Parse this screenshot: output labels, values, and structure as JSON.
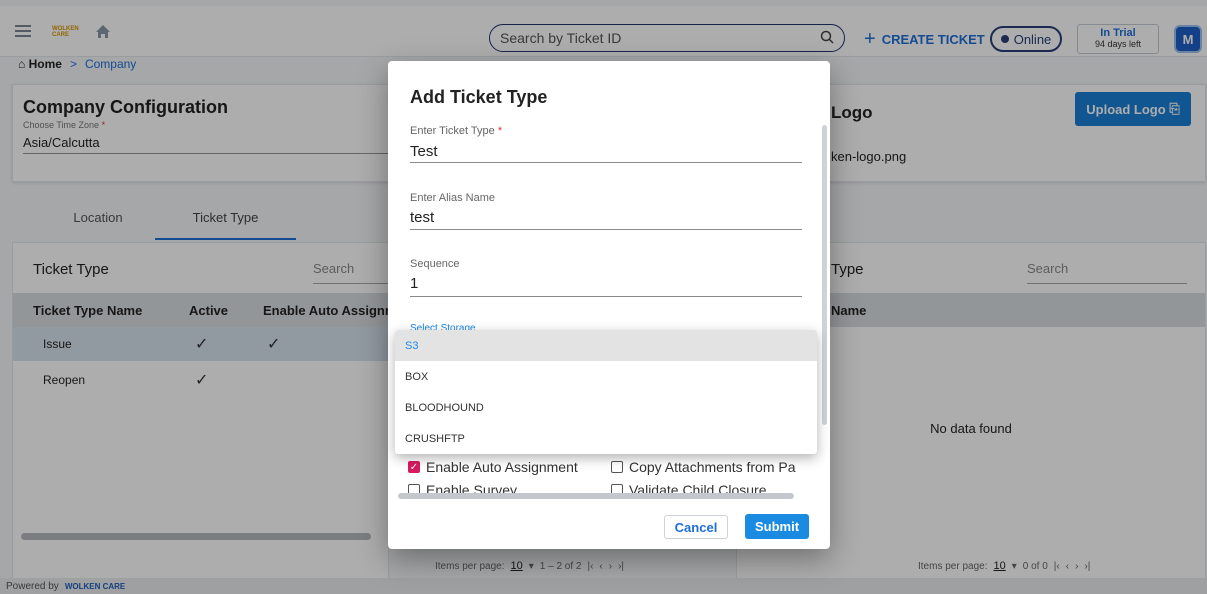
{
  "topbar": {
    "search_placeholder": "Search by Ticket ID",
    "create_ticket_label": "CREATE TICKET",
    "status_label": "Online",
    "trial_title": "In Trial",
    "trial_days": "94 days left",
    "avatar_initial": "M",
    "logo_text": "WOLKEN CARE"
  },
  "breadcrumb": {
    "home": "Home",
    "separator": ">",
    "current": "Company"
  },
  "config": {
    "title": "Company Configuration",
    "timezone_label": "Choose Time Zone",
    "timezone_value": "Asia/Calcutta",
    "logo_title": "Logo",
    "logo_file": "ken-logo.png",
    "upload_label": "Upload Logo"
  },
  "tabs": [
    {
      "label": "Location"
    },
    {
      "label": "Ticket Type"
    }
  ],
  "left_panel": {
    "title": "Ticket Type",
    "search_placeholder": "Search",
    "columns": [
      "Ticket Type Name",
      "Active",
      "Enable Auto Assignr"
    ],
    "rows": [
      {
        "name": "Issue",
        "active": "✓",
        "auto": "✓"
      },
      {
        "name": "Reopen",
        "active": "✓",
        "auto": ""
      }
    ],
    "pager_label": "Items per page:",
    "pager_value": "10",
    "pager_range": "1 – 2 of 2"
  },
  "right_panel": {
    "title": "Type",
    "search_placeholder": "Search",
    "column": "Name",
    "empty_text": "No data found",
    "pager_label": "Items per page:",
    "pager_value": "10",
    "pager_range": "0 of 0"
  },
  "footer": {
    "powered_by": "Powered by",
    "brand": "WOLKEN CARE"
  },
  "dialog": {
    "title": "Add Ticket Type",
    "ticket_type_label": "Enter Ticket Type",
    "ticket_type_value": "Test",
    "alias_label": "Enter Alias Name",
    "alias_value": "test",
    "sequence_label": "Sequence",
    "sequence_value": "1",
    "storage_label": "Select Storage",
    "checkboxes": [
      {
        "label": "Enable Auto Assignment",
        "checked": true
      },
      {
        "label": "Copy Attachments from Pa",
        "checked": false
      },
      {
        "label": "Enable Survey",
        "checked": false
      },
      {
        "label": "Validate Child Closure",
        "checked": false
      }
    ],
    "cancel_label": "Cancel",
    "submit_label": "Submit"
  },
  "storage_options": [
    {
      "label": "S3",
      "selected": true
    },
    {
      "label": "BOX",
      "selected": false
    },
    {
      "label": "BLOODHOUND",
      "selected": false
    },
    {
      "label": "CRUSHFTP",
      "selected": false
    }
  ],
  "colors": {
    "accent": "#1e6fd9",
    "primary_button": "#1a8be0",
    "checkbox_checked": "#d81b60",
    "navy": "#23356b"
  }
}
